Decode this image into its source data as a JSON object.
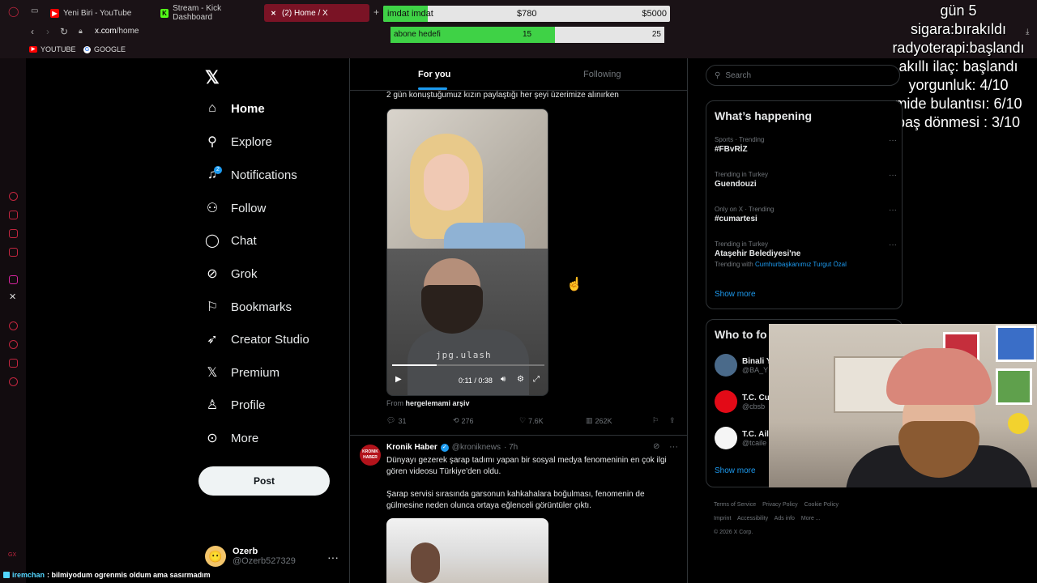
{
  "browser": {
    "tabs": [
      {
        "label": "Yeni Biri - YouTube",
        "color": "#ff0000"
      },
      {
        "label": "Stream - Kick Dashboard",
        "color": "#53fc18"
      },
      {
        "label": "(2) Home / X",
        "color": "#000000"
      }
    ],
    "url_host": "x.com",
    "url_path": "/home",
    "bookmarks": [
      "YOUTUBE",
      "GOOGLE"
    ]
  },
  "overlay": {
    "donation": {
      "label": "imdat imdat",
      "current": "$780",
      "target": "$5000",
      "progress": 0.156
    },
    "subs": {
      "label": "abone hedefi",
      "current": "15",
      "target": "25",
      "progress": 0.6
    },
    "stats": [
      "gün 5",
      "sigara:bırakıldı",
      "radyoterapi:başlandı",
      "akıllı ilaç: başlandı",
      "yorgunluk:  4/10",
      "mide bulantısı: 6/10",
      "baş dönmesi : 3/10"
    ]
  },
  "nav": {
    "items": [
      {
        "label": "Home",
        "icon": "home-icon"
      },
      {
        "label": "Explore",
        "icon": "search-icon"
      },
      {
        "label": "Notifications",
        "icon": "bell-icon"
      },
      {
        "label": "Follow",
        "icon": "add-user-icon"
      },
      {
        "label": "Chat",
        "icon": "chat-icon"
      },
      {
        "label": "Grok",
        "icon": "grok-icon"
      },
      {
        "label": "Bookmarks",
        "icon": "bookmark-icon"
      },
      {
        "label": "Creator Studio",
        "icon": "rocket-icon"
      },
      {
        "label": "Premium",
        "icon": "x-logo-icon"
      },
      {
        "label": "Profile",
        "icon": "person-icon"
      },
      {
        "label": "More",
        "icon": "more-circle-icon"
      }
    ],
    "notif_count": "2",
    "post_label": "Post",
    "user": {
      "name": "Ozerb",
      "handle": "@Ozerb527329"
    }
  },
  "feed": {
    "tabs": [
      "For you",
      "Following"
    ],
    "tweet1": {
      "text": "2 gün konuştuğumuz kızın paylaştığı her şeyi üzerimize alınırken",
      "watermark": "jpg.ulash",
      "time": "0:11 / 0:38",
      "progress": 0.29,
      "source_prefix": "From",
      "source_name": "hergelemami arşiv",
      "replies": "31",
      "reposts": "276",
      "likes": "7.6K",
      "views": "262K"
    },
    "tweet2": {
      "avatar_text": "KRONIK HABER",
      "name": "Kronik Haber",
      "handle": "@kroniknews",
      "time": "· 7h",
      "body1": "Dünyayı gezerek şarap tadımı yapan bir sosyal medya fenomeninin en çok ilgi gören videosu Türkiye'den oldu.",
      "body2": "Şarap servisi sırasında garsonun kahkahalara boğulması, fenomenin de gülmesine neden olunca ortaya eğlenceli görüntüler çıktı."
    }
  },
  "right": {
    "search_placeholder": "Search",
    "happening_title": "What’s happening",
    "trends": [
      {
        "meta": "Sports · Trending",
        "name": "#FBvRİZ"
      },
      {
        "meta": "Trending in Turkey",
        "name": "Guendouzi"
      },
      {
        "meta": "Only on X · Trending",
        "name": "#cumartesi"
      },
      {
        "meta": "Trending in Turkey",
        "name": "Ataşehir Belediyesi'ne",
        "with_prefix": "Trending with",
        "with": "Cumhurbaşkanımız Turgut Özal"
      }
    ],
    "show_more": "Show more",
    "wtf_title": "Who to fo",
    "wtf": [
      {
        "name": "Binali Y",
        "handle": "@BA_Y",
        "color": "#4a6a8a"
      },
      {
        "name": "T.C. Cu",
        "handle": "@cbsb",
        "color": "#e30a17"
      },
      {
        "name": "T.C. Ail",
        "handle": "@tcaile",
        "color": "#f5f5f5"
      }
    ],
    "footer": [
      "Terms of Service",
      "Privacy Policy",
      "Cookie Policy",
      "Imprint",
      "Accessibility",
      "Ads info",
      "More ...",
      "© 2026 X Corp."
    ]
  },
  "chat": {
    "user": "iremchan",
    "message": ": bilmiyodum ogrenmis oldum ama sasırmadım"
  }
}
